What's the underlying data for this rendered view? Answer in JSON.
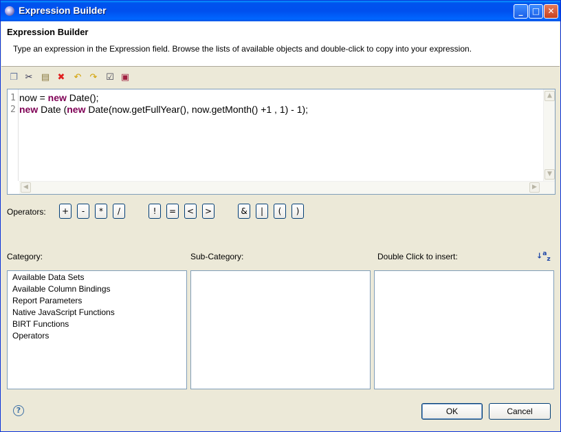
{
  "window": {
    "title": "Expression Builder"
  },
  "title_buttons": {
    "minimize": "_",
    "maximize": "□",
    "close": "✕"
  },
  "header": {
    "title": "Expression Builder",
    "description": "Type an expression in the Expression field. Browse the lists of available objects and double-click to copy into your expression."
  },
  "toolbar": {
    "icons": [
      "copy-icon",
      "cut-icon",
      "paste-icon",
      "delete-icon",
      "undo-icon",
      "redo-icon",
      "validate-icon",
      "preview-icon"
    ]
  },
  "editor": {
    "line_numbers": [
      "1",
      "2"
    ],
    "lines": [
      [
        {
          "t": "now = ",
          "k": false
        },
        {
          "t": "new",
          "k": true
        },
        {
          "t": " Date();",
          "k": false
        }
      ],
      [
        {
          "t": "new",
          "k": true
        },
        {
          "t": " Date (",
          "k": false
        },
        {
          "t": "new",
          "k": true
        },
        {
          "t": " Date(now.getFullYear(), now.getMonth() +1 , 1) - 1);",
          "k": false
        }
      ]
    ]
  },
  "operators": {
    "label": "Operators:",
    "buttons": [
      "+",
      "-",
      "*",
      "/",
      "!",
      "=",
      "<",
      ">",
      "&",
      "|",
      "(",
      ")"
    ]
  },
  "lists": {
    "category_label": "Category:",
    "subcategory_label": "Sub-Category:",
    "insert_label": "Double Click to insert:",
    "categories": [
      "Available Data Sets",
      "Available Column Bindings",
      "Report Parameters",
      "Native JavaScript Functions",
      "BIRT Functions",
      "Operators"
    ],
    "sort_icon": "sort-az-icon"
  },
  "footer": {
    "ok": "OK",
    "cancel": "Cancel",
    "help": "?"
  }
}
